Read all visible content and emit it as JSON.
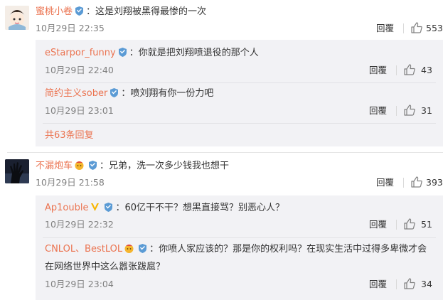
{
  "comments": [
    {
      "user": "蜜桃小卷",
      "text": "：这是刘翔被黑得最惨的一次",
      "time": "10月29日 22:35",
      "reply_label": "回覆",
      "likes": "553",
      "replies": [
        {
          "user": "eStarpor_funny",
          "text": "：你就是把刘翔喷退役的那个人",
          "time": "10月29日 22:40",
          "reply_label": "回覆",
          "likes": "43"
        },
        {
          "user": "简约主义sober",
          "text": "：喷刘翔有你一份力吧",
          "time": "10月29日 23:01",
          "reply_label": "回覆",
          "likes": "31"
        }
      ],
      "more_replies": "共63条回复"
    },
    {
      "user": "不漏炮车",
      "text": "：兄弟，洗一次多少钱我也想干",
      "time": "10月29日 21:58",
      "reply_label": "回覆",
      "likes": "393",
      "replies": [
        {
          "user": "Ap1ouble",
          "text": "：60亿干不干？想黑直接骂？别恶心人？",
          "time": "10月29日 22:32",
          "reply_label": "回覆",
          "likes": "51"
        },
        {
          "user": "CNLOL、BestLOL",
          "text": "：你喷人家应该的？那是你的权利吗？在现实生活中过得多卑微才会",
          "text2": "在网络世界中这么嚣张跋扈？",
          "time": "10月29日 23:04",
          "reply_label": "回覆",
          "likes": "34"
        }
      ]
    }
  ]
}
